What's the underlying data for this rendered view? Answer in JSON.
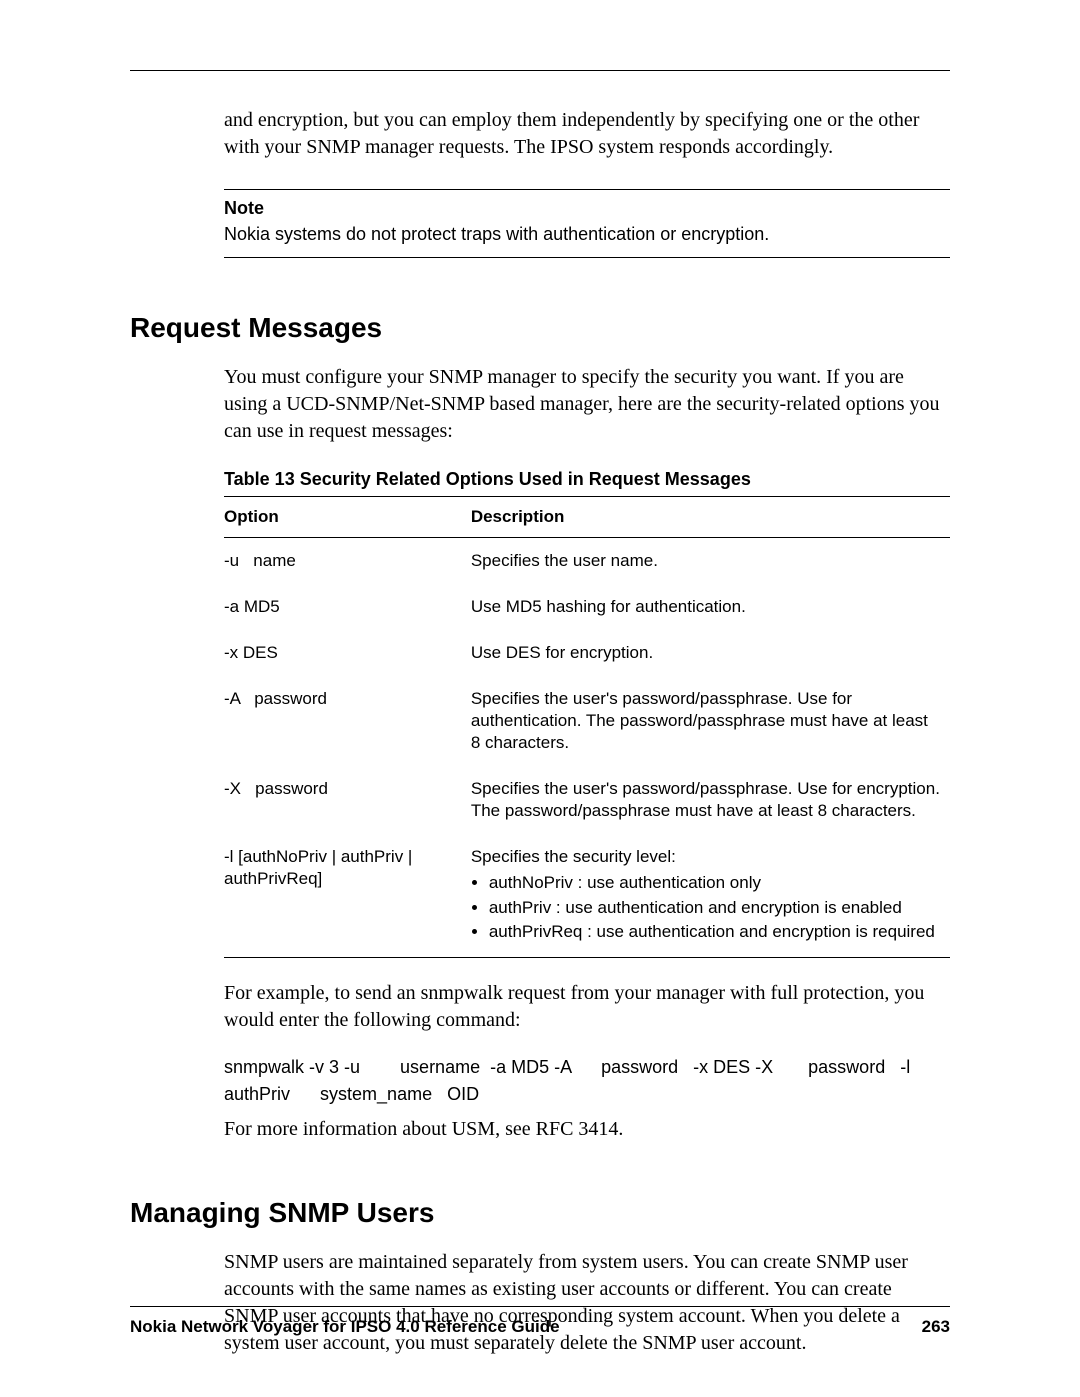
{
  "intro_para": "and encryption, but you can employ them independently by specifying one or the other with your SNMP manager requests. The IPSO system responds accordingly.",
  "note": {
    "label": "Note",
    "text": "Nokia systems do not protect traps with authentication or encryption."
  },
  "section1": {
    "heading": "Request Messages",
    "para": "You must configure your SNMP manager to specify the security you want. If you are using a UCD-SNMP/Net-SNMP based manager, here are the security-related options you can use in request messages:",
    "table_caption": "Table 13  Security Related Options Used in Request Messages",
    "col_option": "Option",
    "col_desc": "Description",
    "rows": {
      "r0": {
        "opt": "-u   name",
        "desc": "Specifies the user name."
      },
      "r1": {
        "opt": "-a MD5",
        "desc": "Use MD5 hashing for authentication."
      },
      "r2": {
        "opt": "-x DES",
        "desc": "Use DES for encryption."
      },
      "r3": {
        "opt": "-A   password",
        "desc": "Specifies the user's password/passphrase. Use for authentication. The password/passphrase must have at least 8 characters."
      },
      "r4": {
        "opt": "-X   password",
        "desc": "Specifies the user's password/passphrase. Use for encryption. The password/passphrase must have at least 8 characters."
      },
      "r5": {
        "opt": "-l [authNoPriv | authPriv | authPrivReq]",
        "desc_lead": "Specifies the security level:",
        "b1": "authNoPriv    : use authentication only",
        "b2": "authPriv    : use authentication and encryption is enabled",
        "b3": "authPrivReq    : use authentication and encryption is required"
      }
    },
    "example_para": "For example, to send an snmpwalk request from your manager with full protection, you would enter the following command:",
    "command": "snmpwalk -v 3 -u        username  -a MD5 -A      password   -x DES -X       password   -l authPriv      system_name   OID",
    "usm_para": "For more information about USM, see RFC 3414."
  },
  "section2": {
    "heading": "Managing SNMP Users",
    "para": "SNMP users are maintained separately from system users. You can create SNMP user accounts with the same names as existing user accounts or different. You can create SNMP user accounts that have no corresponding system account. When you delete a system user account, you must separately delete the SNMP user account."
  },
  "footer": {
    "title": "Nokia Network Voyager for IPSO 4.0 Reference Guide",
    "page": "263"
  }
}
